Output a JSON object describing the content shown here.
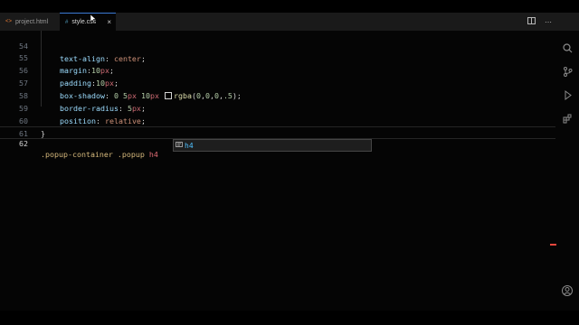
{
  "tabs": [
    {
      "label": "project.html",
      "icon": "html-file-icon"
    },
    {
      "label": "style.css",
      "icon": "css-file-icon",
      "close": "×"
    }
  ],
  "tab_actions": [
    "split-editor-icon",
    "more-actions-icon"
  ],
  "editor": {
    "lines": [
      {
        "num": "54",
        "text": "text-align: center;"
      },
      {
        "num": "55",
        "text": "margin:10px;"
      },
      {
        "num": "56",
        "text": "padding:10px;"
      },
      {
        "num": "57",
        "text": "box-shadow: 0 5px 10px rgba(0,0,0,.5);"
      },
      {
        "num": "58",
        "text": "border-radius: 5px;"
      },
      {
        "num": "59",
        "text": "position: relative;"
      },
      {
        "num": "60",
        "text": "}"
      },
      {
        "num": "61",
        "text": ""
      },
      {
        "num": "62",
        "text": ".popup-container .popup h4"
      }
    ],
    "suggestion": {
      "icon": "snippet-icon",
      "text": "h4"
    }
  },
  "activity_bar": [
    "search-icon",
    "source-control-icon",
    "run-debug-icon",
    "extensions-icon",
    "account-icon"
  ],
  "colors": {
    "accent": "#3c7bd6",
    "background": "#050505",
    "error_marker": "#e8473d"
  }
}
